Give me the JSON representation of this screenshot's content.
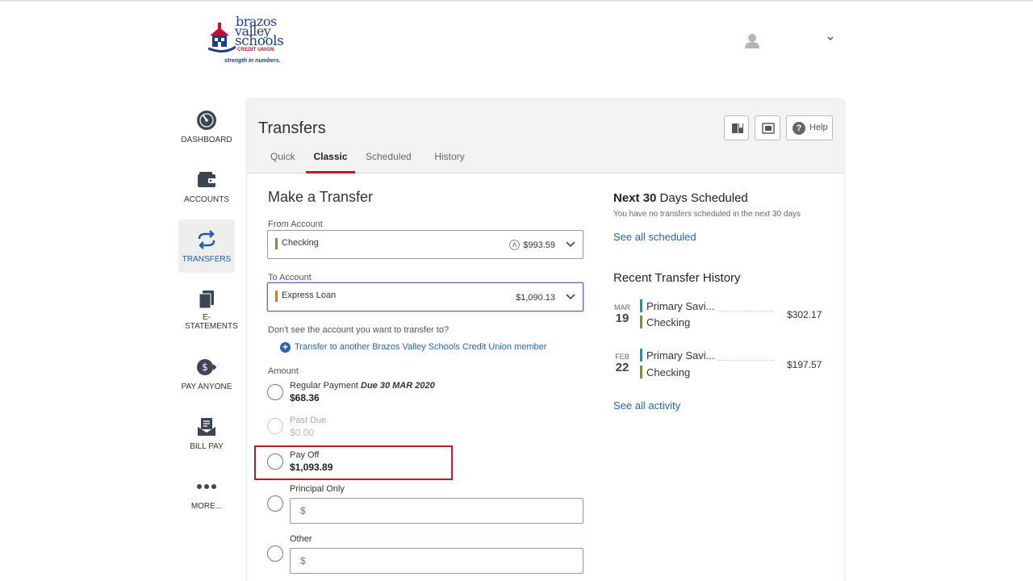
{
  "brand": {
    "line1": "brazos",
    "line2": "valley",
    "line3": "schools",
    "line4": "CREDIT UNION",
    "tagline": "strength in numbers."
  },
  "user_menu": {
    "icon": "user-icon",
    "chevron": "chevron-down-icon"
  },
  "nav": [
    {
      "label": "DASHBOARD",
      "icon": "gauge-icon"
    },
    {
      "label": "ACCOUNTS",
      "icon": "wallet-icon"
    },
    {
      "label": "TRANSFERS",
      "icon": "transfer-arrows-icon",
      "active": true
    },
    {
      "label": "E-STATEMENTS",
      "icon": "documents-icon"
    },
    {
      "label": "PAY ANYONE",
      "icon": "pay-anyone-icon"
    },
    {
      "label": "BILL PAY",
      "icon": "bill-pay-icon"
    },
    {
      "label": "MORE...",
      "icon": "more-dots-icon"
    }
  ],
  "page": {
    "title": "Transfers",
    "tabs": [
      "Quick",
      "Classic",
      "Scheduled",
      "History"
    ],
    "active_tab": "Classic",
    "help_label": "Help"
  },
  "form": {
    "title": "Make a Transfer",
    "from_label": "From Account",
    "from": {
      "name": "Checking",
      "available_marker": "A",
      "amount": "$993.59",
      "color": "#6a9a2e"
    },
    "to_label": "To Account",
    "to": {
      "name": "Express Loan",
      "amount": "$1,090.13",
      "color": "#e07b00"
    },
    "missing_account_text": "Don't see the account you want to transfer to?",
    "member_transfer_link": "Transfer to another Brazos Valley Schools Credit Union member",
    "amount_label": "Amount",
    "options": [
      {
        "label": "Regular Payment",
        "due": "Due 30 MAR 2020",
        "value": "$68.36"
      },
      {
        "label": "Past Due",
        "value": "$0.00",
        "disabled": true
      },
      {
        "label": "Pay Off",
        "value": "$1,093.89"
      },
      {
        "label": "Principal Only",
        "placeholder": "$"
      },
      {
        "label": "Other",
        "placeholder": "$"
      }
    ]
  },
  "scheduled": {
    "title_pre": "Next ",
    "title_num": "30",
    "title_post": " Days Scheduled",
    "empty_text": "You have no transfers scheduled in the next 30 days",
    "link": "See all scheduled"
  },
  "history": {
    "title": "Recent Transfer History",
    "items": [
      {
        "month": "MAR",
        "day": "19",
        "from": "Primary Savi...",
        "to": "Checking",
        "amount": "$302.17",
        "from_color": "#1a8fc9",
        "to_color": "#6a9a2e"
      },
      {
        "month": "FEB",
        "day": "22",
        "from": "Primary Savi...",
        "to": "Checking",
        "amount": "$197.57",
        "from_color": "#1a8fc9",
        "to_color": "#6a9a2e"
      }
    ],
    "link": "See all activity"
  }
}
